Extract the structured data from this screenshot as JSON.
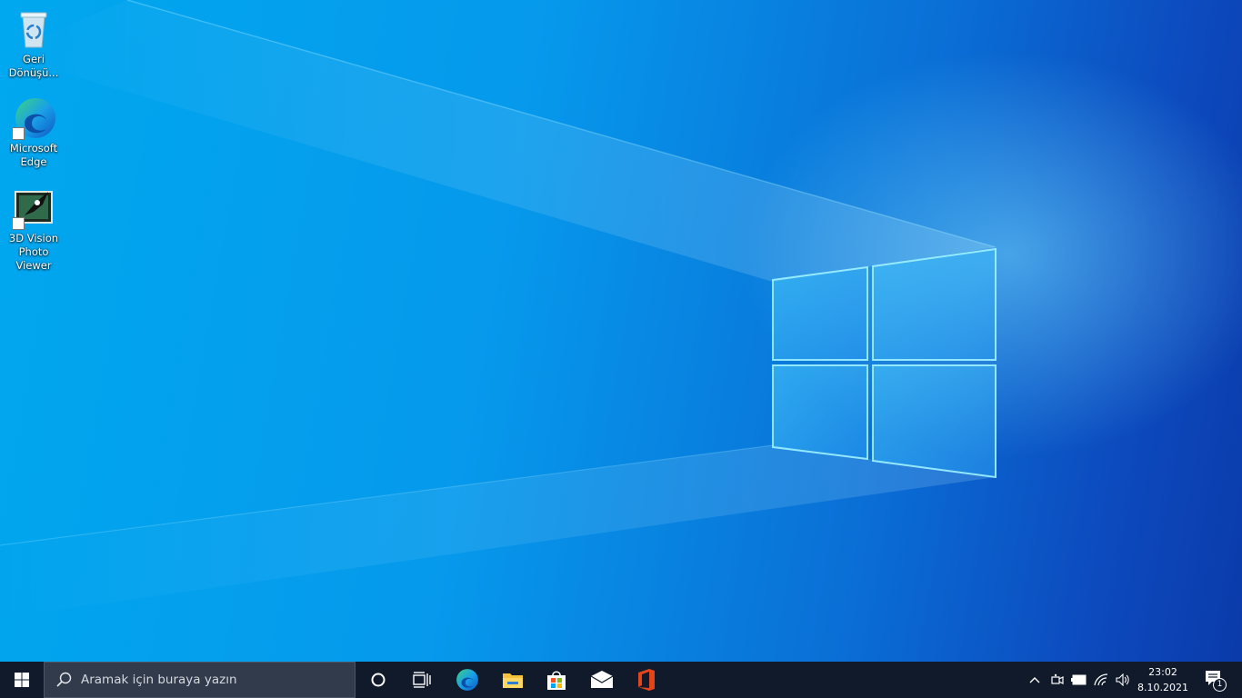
{
  "desktop": {
    "icons": [
      {
        "label": "Geri Dönüşü...",
        "icon": "recycle-bin-icon"
      },
      {
        "label": "Microsoft Edge",
        "icon": "edge-icon"
      },
      {
        "label": "3D Vision Photo Viewer",
        "icon": "3d-vision-icon"
      }
    ]
  },
  "taskbar": {
    "start_icon": "windows-logo-icon",
    "search_placeholder": "Aramak için buraya yazın",
    "pinned": [
      {
        "icon": "cortana-icon"
      },
      {
        "icon": "task-view-icon"
      },
      {
        "icon": "edge-icon"
      },
      {
        "icon": "file-explorer-icon"
      },
      {
        "icon": "microsoft-store-icon"
      },
      {
        "icon": "mail-icon"
      },
      {
        "icon": "office-icon"
      }
    ],
    "tray": {
      "time": "23:02",
      "date": "8.10.2021",
      "notification_count": "1"
    }
  },
  "colors": {
    "taskbar_bg": "#101a2b",
    "search_bg": "#313b4c",
    "wallpaper_light": "#00a8ef",
    "wallpaper_dark": "#0b3aaa"
  }
}
